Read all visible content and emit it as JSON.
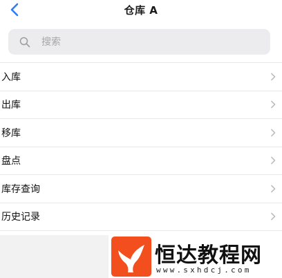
{
  "nav": {
    "title": "仓库 A",
    "back_icon": "chevron-left-icon",
    "accent_color": "#2f7cf6"
  },
  "search": {
    "placeholder": "搜索",
    "value": "",
    "icon": "search-icon"
  },
  "menu": {
    "items": [
      {
        "label": "入库"
      },
      {
        "label": "出库"
      },
      {
        "label": "移库"
      },
      {
        "label": "盘点"
      },
      {
        "label": "库存查询"
      },
      {
        "label": "历史记录"
      }
    ],
    "chevron_icon": "chevron-right-icon"
  },
  "watermark": {
    "title": "恒达教程网",
    "url": "www.sxhdcj.com",
    "brand_color": "#f24e1e"
  }
}
